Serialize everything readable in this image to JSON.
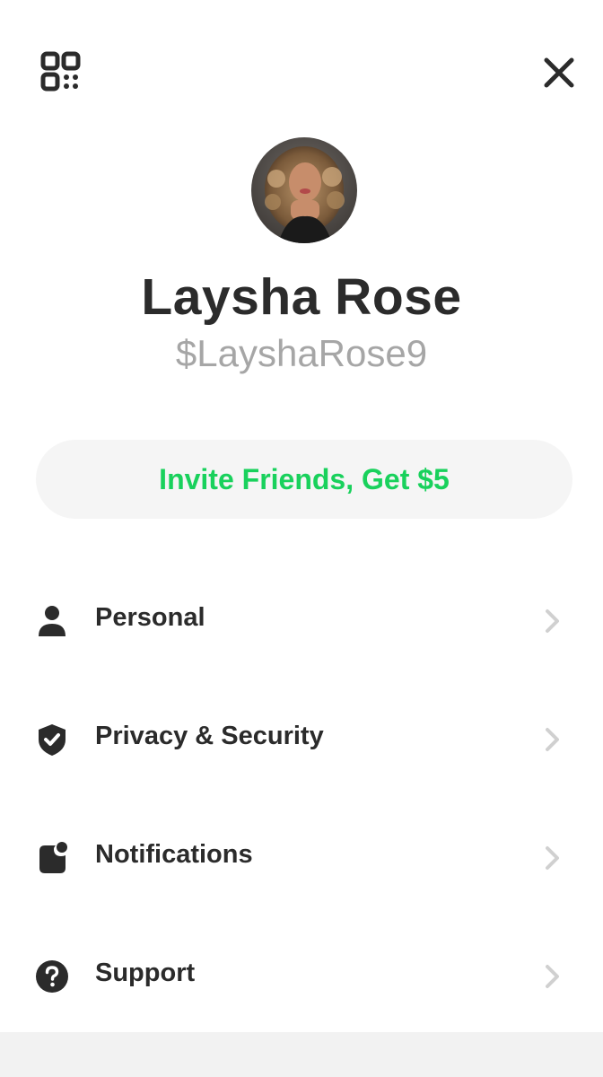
{
  "profile": {
    "name": "Laysha Rose",
    "cashtag": "$LayshaRose9"
  },
  "invite": {
    "label": "Invite Friends, Get $5"
  },
  "menu": {
    "items": [
      {
        "label": "Personal",
        "icon": "person-icon"
      },
      {
        "label": "Privacy & Security",
        "icon": "shield-check-icon"
      },
      {
        "label": "Notifications",
        "icon": "notification-badge-icon"
      },
      {
        "label": "Support",
        "icon": "question-circle-icon"
      }
    ]
  },
  "header": {
    "left_icon": "qr-code-icon",
    "right_icon": "close-icon"
  },
  "colors": {
    "accent_green": "#19d15c",
    "text_dark": "#2b2b2b",
    "text_muted": "#a6a6a6",
    "pill_bg": "#f5f5f5",
    "chevron": "#d0d0d0"
  }
}
